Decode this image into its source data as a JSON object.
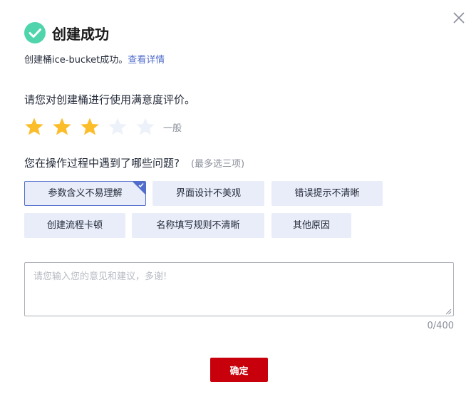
{
  "dialog": {
    "title": "创建成功",
    "success_prefix": "创建桶ice-bucket成功。",
    "details_link": "查看详情",
    "close_icon": "close-icon",
    "success_icon": "check-circle-icon",
    "accent_color": "#526ecc",
    "success_color": "#50d4ab"
  },
  "rating": {
    "question": "请您对创建桶进行使用满意度评价。",
    "value": 3,
    "max": 5,
    "level_label": "一般",
    "star_color_filled": "#fcbd2b",
    "star_color_empty": "#edf1f9"
  },
  "issues": {
    "question": "您在操作过程中遇到了哪些问题?",
    "hint": "(最多选三项)",
    "options": [
      {
        "label": "参数含义不易理解",
        "selected": true
      },
      {
        "label": "界面设计不美观",
        "selected": false
      },
      {
        "label": "错误提示不清晰",
        "selected": false
      },
      {
        "label": "创建流程卡顿",
        "selected": false
      },
      {
        "label": "名称填写规则不清晰",
        "selected": false
      },
      {
        "label": "其他原因",
        "selected": false
      }
    ]
  },
  "feedback": {
    "placeholder": "请您输入您的意见和建议，多谢!",
    "value": "",
    "counter": "0/400"
  },
  "actions": {
    "confirm_label": "确定",
    "confirm_color": "#c7000b"
  }
}
